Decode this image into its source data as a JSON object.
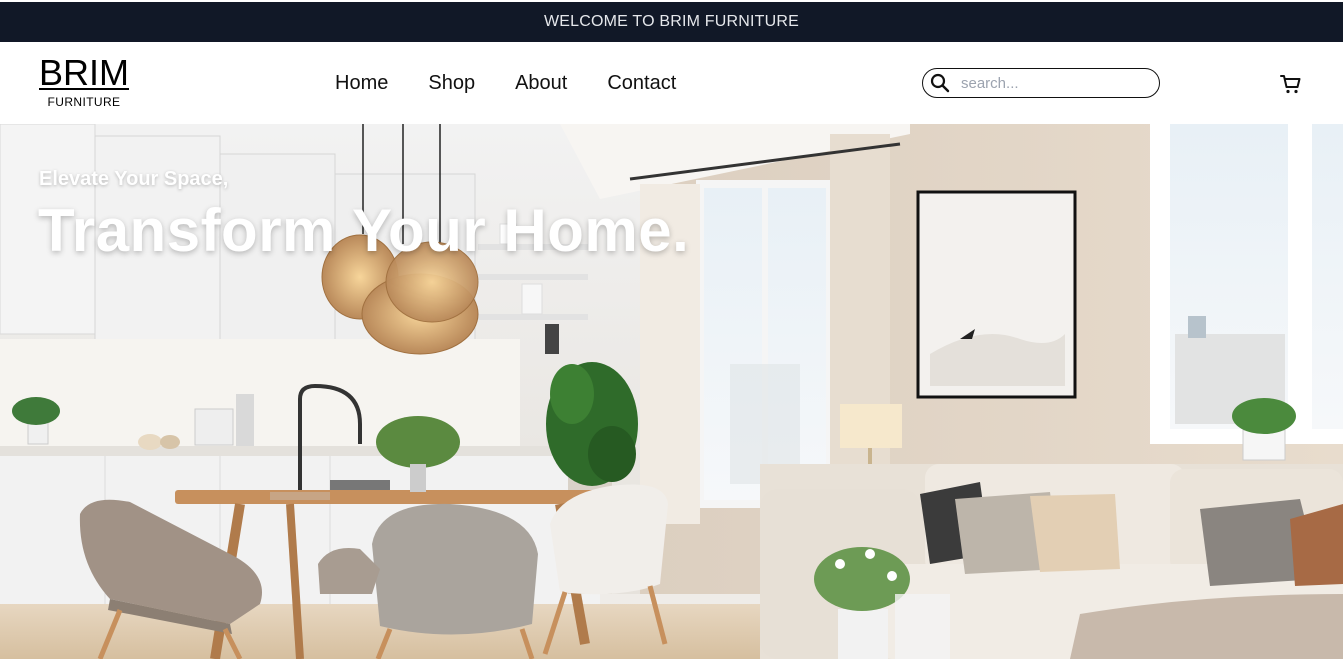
{
  "announcement": {
    "text": "WELCOME TO BRIM FURNITURE"
  },
  "brand": {
    "name": "BRIM",
    "tagline": "FURNITURE"
  },
  "nav": {
    "items": [
      {
        "label": "Home"
      },
      {
        "label": "Shop"
      },
      {
        "label": "About"
      },
      {
        "label": "Contact"
      }
    ]
  },
  "search": {
    "placeholder": "search...",
    "value": "",
    "icon": "search-icon"
  },
  "cart": {
    "icon": "cart-icon"
  },
  "hero": {
    "subtitle": "Elevate Your Space,",
    "title": "Transform Your Home.",
    "image": "interior-living-dining-room"
  },
  "colors": {
    "topbar_bg": "#111827",
    "topbar_text": "#e5e7eb",
    "hero_text": "#ffffff"
  }
}
